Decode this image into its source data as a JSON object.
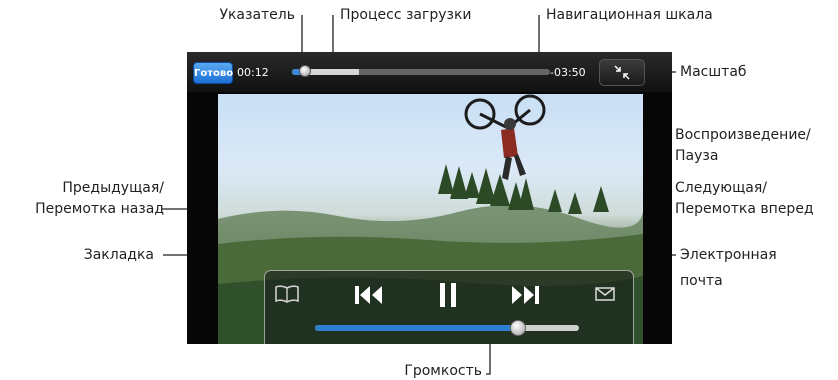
{
  "callouts": {
    "pointer": "Указатель",
    "load_progress": "Процесс загрузки",
    "nav_scale": "Навигационная шкала",
    "scale": "Масштаб",
    "play_pause_1": "Воспроизведение/",
    "play_pause_2": "Пауза",
    "prev_1": "Предыдущая/",
    "prev_2": "Перемотка назад",
    "next_1": "Следующая/",
    "next_2": "Перемотка вперед",
    "bookmark": "Закладка",
    "email_1": "Электронная",
    "email_2": "почта",
    "volume": "Громкость"
  },
  "player": {
    "done_label": "Готово",
    "elapsed": "00:12",
    "remaining": "-03:50",
    "playback_fraction": 0.05,
    "loaded_fraction": 0.26,
    "volume_fraction": 0.77
  },
  "colors": {
    "accent": "#2e7fd0",
    "done_button": "#1c6fd6",
    "leader": "#231f20"
  },
  "icons": {
    "bookmark": "book-icon",
    "previous": "skip-back-icon",
    "play_pause": "pause-icon",
    "next": "skip-forward-icon",
    "email": "envelope-icon",
    "scale": "shrink-arrows-icon"
  }
}
